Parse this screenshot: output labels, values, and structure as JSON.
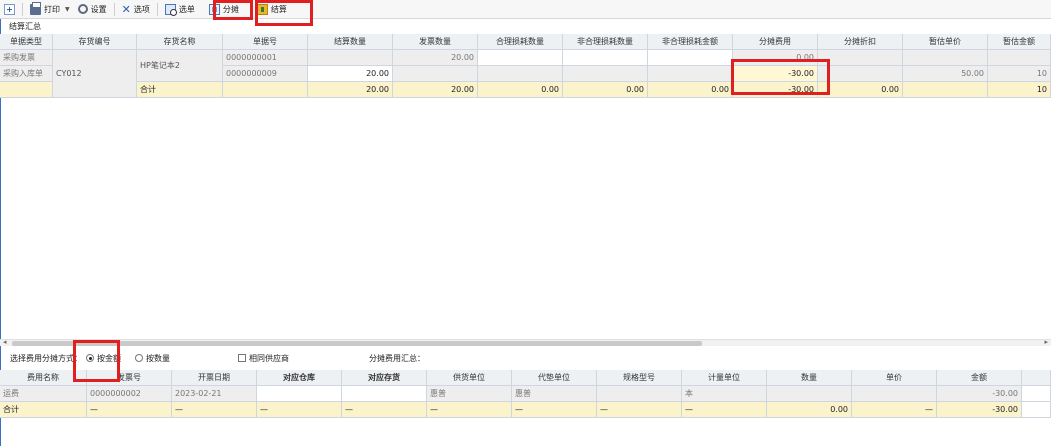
{
  "toolbar": {
    "print": "打印",
    "settings": "设置",
    "options": "选项",
    "select_doc": "选单",
    "allocate": "分摊",
    "settle": "结算"
  },
  "summary_title": "结算汇总",
  "top_table": {
    "headers": [
      "单据类型",
      "存货编号",
      "存货名称",
      "单据号",
      "结算数量",
      "发票数量",
      "合理损耗数量",
      "非合理损耗数量",
      "非合理损耗金额",
      "分摊费用",
      "分摊折扣",
      "暂估单价",
      "暂估金额"
    ],
    "rows": [
      {
        "doc_type": "采购发票",
        "doc_no": "0000000001",
        "settle_qty": "",
        "invoice_qty": "20.00",
        "alloc_fee": "0.00"
      },
      {
        "doc_type": "采购入库单",
        "doc_no": "0000000009",
        "settle_qty": "20.00",
        "invoice_qty": "",
        "alloc_fee": "-30.00",
        "est_price": "50.00",
        "est_amount": "10"
      }
    ],
    "merged": {
      "inv_code": "CY012",
      "inv_name": "HP笔记本2"
    },
    "total": {
      "label": "合计",
      "settle_qty": "20.00",
      "invoice_qty": "20.00",
      "reasonable_loss": "0.00",
      "unreasonable_loss_qty": "0.00",
      "unreasonable_loss_amt": "0.00",
      "alloc_fee": "-30.00",
      "alloc_discount": "0.00",
      "est_amount": "10"
    }
  },
  "allocation": {
    "label": "选择费用分摊方式：",
    "by_amount": "按金额",
    "by_quantity": "按数量",
    "selected": "by_amount",
    "same_supplier": "相同供应商",
    "fee_summary": "分摊费用汇总："
  },
  "bottom_table": {
    "headers": [
      "费用名称",
      "发票号",
      "开票日期",
      "对应仓库",
      "对应存货",
      "供货单位",
      "代垫单位",
      "规格型号",
      "计量单位",
      "数量",
      "单价",
      "金额"
    ],
    "rows": [
      {
        "fee_name": "运费",
        "invoice_no": "0000000002",
        "invoice_date": "2023-02-21",
        "supplier": "惠普",
        "agent": "惠普",
        "unit": "本",
        "amount": "-30.00"
      }
    ],
    "total": {
      "label": "合计",
      "dash": "—",
      "qty": "0.00",
      "amount": "-30.00"
    }
  },
  "highlights": {
    "color": "#e02020"
  }
}
